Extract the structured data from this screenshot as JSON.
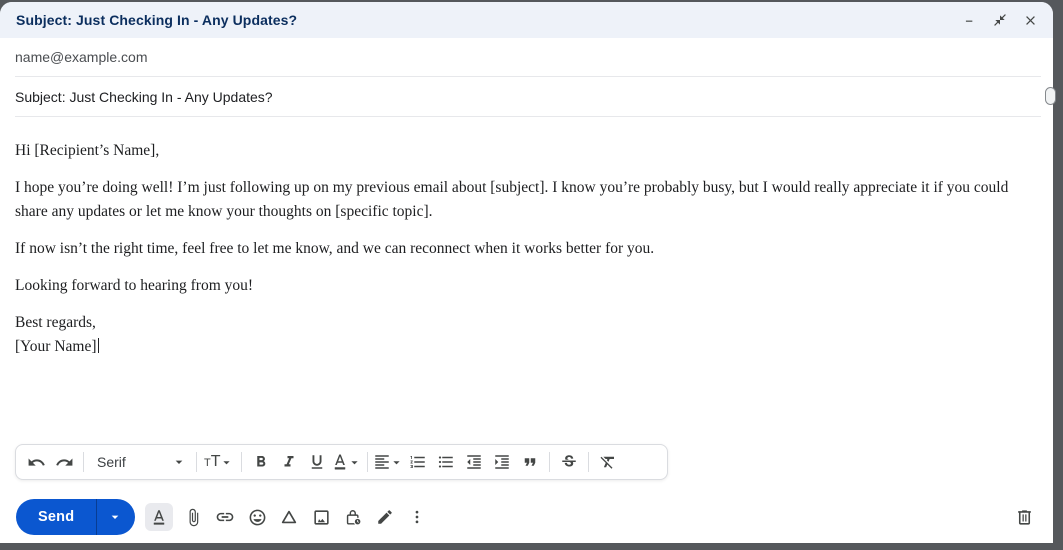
{
  "window": {
    "title": "Subject: Just Checking In - Any Updates?",
    "controls": [
      "minimize",
      "exit-fullscreen",
      "close"
    ]
  },
  "recipient": {
    "value": "name@example.com"
  },
  "subject": {
    "value": "Subject: Just Checking In - Any Updates?"
  },
  "body": {
    "paragraphs": [
      "Hi [Recipient’s Name],",
      "I hope you’re doing well! I’m just following up on my previous email about [subject]. I know you’re probably busy, but I would really appreciate it if you could share any updates or let me know your thoughts on [specific topic].",
      "If now isn’t the right time, feel free to let me know, and we can reconnect when it works better for you.",
      "Looking forward to hearing from you!",
      "Best regards,",
      "[Your Name]"
    ]
  },
  "format_toolbar": {
    "font_family_value": "Serif",
    "font_size_glyph_small": "T",
    "font_size_glyph_large": "T",
    "buttons": [
      "undo",
      "redo",
      "font-family",
      "font-size",
      "bold",
      "italic",
      "underline",
      "text-color",
      "align",
      "numbered-list",
      "bulleted-list",
      "indent-less",
      "indent-more",
      "quote",
      "strikethrough",
      "remove-formatting"
    ]
  },
  "send_toolbar": {
    "send_label": "Send",
    "buttons": [
      "send",
      "send-options",
      "formatting-options",
      "attach-file",
      "insert-link",
      "insert-emoji",
      "insert-from-drive",
      "insert-photo",
      "confidential-mode",
      "insert-signature",
      "more-options",
      "discard-draft"
    ]
  },
  "colors": {
    "accent_blue": "#0b57d0",
    "titlebar_bg": "#eef2f9",
    "title_text": "#0b2e5e",
    "icon_gray": "#444746",
    "desktop_bg": "#55585c",
    "divider": "#e7e8eb"
  }
}
